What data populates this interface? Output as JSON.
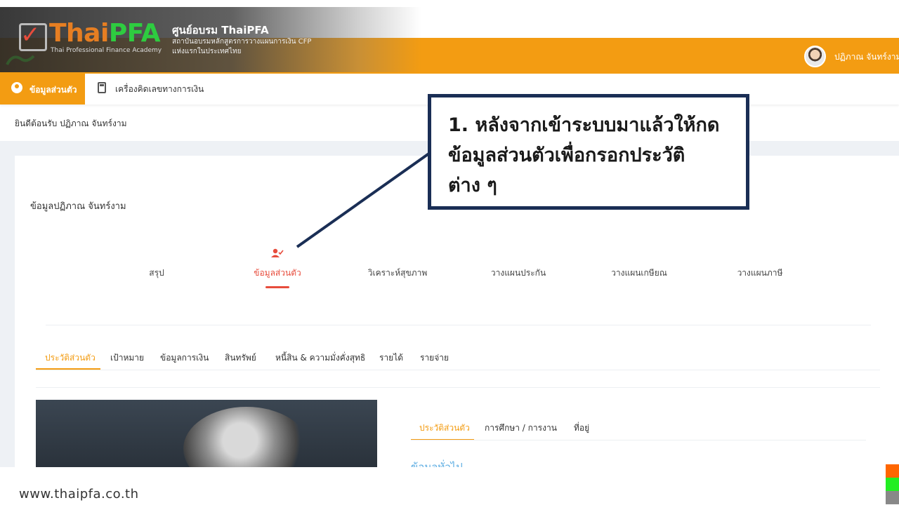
{
  "header": {
    "logo": {
      "part1": "Thai",
      "part2": "PFA",
      "tagline": "Thai Professional Finance Academy"
    },
    "org_title": "ศูนย์อบรม ThaiPFA",
    "org_subtitle_line1": "สถาบันอบรมหลักสูตรการวางแผนการเงิน CFP",
    "org_subtitle_line2": "แห่งแรกในประเทศไทย",
    "user_name": "ปฏิภาณ จันทร์งาม"
  },
  "nav": {
    "items": [
      {
        "label": "ข้อมูลส่วนตัว",
        "icon": "user-circle-icon",
        "active": true
      },
      {
        "label": "เครื่องคิดเลขทางการเงิน",
        "icon": "calculator-icon",
        "active": false
      }
    ]
  },
  "welcome_text": "ยินดีต้อนรับ ปฏิภาณ จันทร์งาม",
  "card": {
    "title": "ข้อมูลปฏิภาณ จันทร์งาม",
    "steps": [
      "สรุป",
      "ข้อมูลส่วนตัว",
      "วิเคราะห์สุขภาพ",
      "วางแผนประกัน",
      "วางแผนเกษียณ",
      "วางแผนภาษี"
    ],
    "active_step": 1,
    "sub_tabs": [
      "ประวัติส่วนตัว",
      "เป้าหมาย",
      "ข้อมูลการเงิน",
      "สินทรัพย์",
      "หนี้สิน & ความมั่งคั่งสุทธิ",
      "รายได้",
      "รายจ่าย"
    ],
    "profile_tabs": [
      "ประวัติส่วนตัว",
      "การศึกษา / การงาน",
      "ที่อยู่"
    ],
    "section_heading": "ข้อมูลทั่วไป"
  },
  "callout": {
    "line1": "1. หลังจากเข้าระบบมาแล้วให้กด",
    "line2": "ข้อมูลส่วนตัวเพื่อกรอกประวัติ",
    "line3": "ต่าง ๆ"
  },
  "footer": {
    "url": "www.thaipfa.co.th",
    "colors": [
      "#ff6600",
      "#22ee22",
      "#888888"
    ]
  },
  "colors": {
    "accent": "#f39c12",
    "active_step": "#e74c3c",
    "callout_border": "#1a2e55"
  }
}
